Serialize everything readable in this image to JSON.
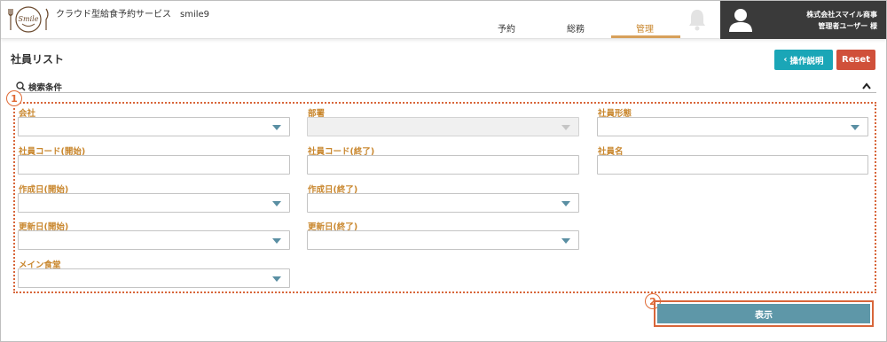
{
  "header": {
    "logo_text": "Smile",
    "app_title": "クラウド型給食予約サービス　smile9",
    "nav": [
      {
        "label": "予約"
      },
      {
        "label": "総務"
      },
      {
        "label": "管理",
        "active": true
      }
    ],
    "company_name": "株式会社スマイル商事",
    "user_name": "管理者ユーザー 様"
  },
  "page": {
    "title": "社員リスト",
    "help_button": "操作説明",
    "reset_button": "Reset"
  },
  "search": {
    "label": "検索条件",
    "fields": [
      {
        "label": "会社",
        "type": "select",
        "value": ""
      },
      {
        "label": "部署",
        "type": "select",
        "value": "",
        "disabled": true
      },
      {
        "label": "社員形態",
        "type": "select",
        "value": ""
      },
      {
        "label": "社員コード(開始)",
        "type": "text",
        "value": ""
      },
      {
        "label": "社員コード(終了)",
        "type": "text",
        "value": ""
      },
      {
        "label": "社員名",
        "type": "text",
        "value": ""
      },
      {
        "label": "作成日(開始)",
        "type": "select",
        "value": ""
      },
      {
        "label": "作成日(終了)",
        "type": "select",
        "value": ""
      },
      {
        "label": "更新日(開始)",
        "type": "select",
        "value": ""
      },
      {
        "label": "更新日(終了)",
        "type": "select",
        "value": ""
      },
      {
        "label": "メイン食堂",
        "type": "select",
        "value": ""
      }
    ]
  },
  "annotations": {
    "badge_1": "1",
    "badge_2": "2"
  },
  "actions": {
    "display_button": "表示"
  },
  "colors": {
    "accent": "#c9872e",
    "help": "#1aa6b7",
    "reset": "#d0503a",
    "display": "#5e97a8",
    "annotation": "#d8663a"
  }
}
